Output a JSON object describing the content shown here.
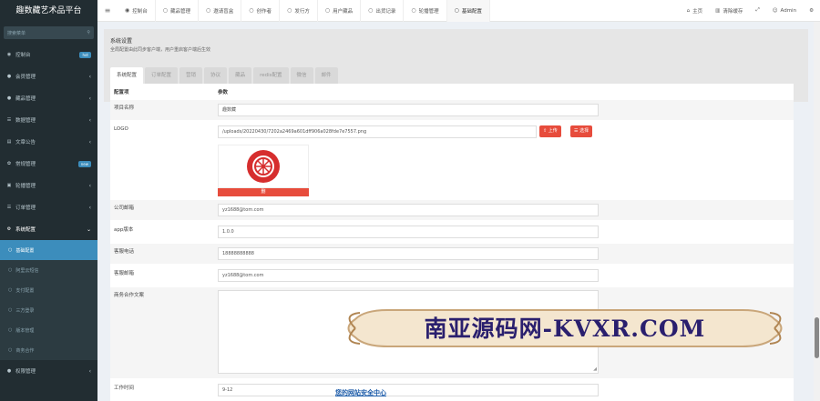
{
  "app": {
    "title": "趣数藏艺术品平台"
  },
  "sidebar": {
    "search_placeholder": "搜索菜单",
    "items": [
      {
        "label": "控制台",
        "badge": "hot",
        "icon": "dashboard-icon"
      },
      {
        "label": "会员管理",
        "icon": "users-icon"
      },
      {
        "label": "藏品管理",
        "icon": "box-icon"
      },
      {
        "label": "数据管理",
        "icon": "list-icon"
      },
      {
        "label": "文章公告",
        "icon": "file-icon"
      },
      {
        "label": "常规管理",
        "badge": "new",
        "icon": "cogs-icon"
      },
      {
        "label": "轮播管理",
        "icon": "image-icon"
      },
      {
        "label": "订单管理",
        "icon": "list-icon"
      },
      {
        "label": "系统配置",
        "icon": "gear-icon"
      }
    ],
    "sub_items": [
      "基础配置",
      "阿里云短信",
      "支付配置",
      "三方登录",
      "版本管理",
      "商务合作"
    ],
    "bottom_item": "权限管理"
  },
  "topbar": {
    "tabs": [
      "控制台",
      "藏品管理",
      "邀请盲盒",
      "创作者",
      "发行方",
      "用户藏品",
      "出货记录",
      "轮播管理",
      "基础配置"
    ],
    "home": "主页",
    "clear_cache": "清除缓存",
    "user": "Admin"
  },
  "panel": {
    "title": "系统设置",
    "subtitle": "全局配置由此同步客户端，用户重启客户端后生效",
    "tabs": [
      "系统配置",
      "订单配置",
      "营销",
      "协议",
      "藏品",
      "redis配置",
      "微信",
      "邮件"
    ]
  },
  "form": {
    "col_key": "配置项",
    "col_val": "参数",
    "fields": [
      {
        "label": "项目名称",
        "value": "趣数藏"
      },
      {
        "label": "LOGO",
        "value": "/uploads/20220430/7202a2469a601dff906a028fde7e7557.png"
      },
      {
        "label": "公司邮箱",
        "value": "yz1688@tom.com"
      },
      {
        "label": "app版本",
        "value": "1.0.0"
      },
      {
        "label": "客服电话",
        "value": "18888888888"
      },
      {
        "label": "客服邮箱",
        "value": "yz1688@tom.com"
      },
      {
        "label": "商务合作文案",
        "value": ""
      },
      {
        "label": "工作时间",
        "value": "9-12"
      }
    ],
    "upload_label": "上传",
    "choose_label": "选择",
    "delete_label": "删"
  },
  "watermark": {
    "text": "南亚源码网-KVXR.COM",
    "caption": "您的网站安全中心"
  },
  "colors": {
    "sidebar": "#222d32",
    "accent": "#3c8dbc",
    "danger": "#e74c3c"
  }
}
